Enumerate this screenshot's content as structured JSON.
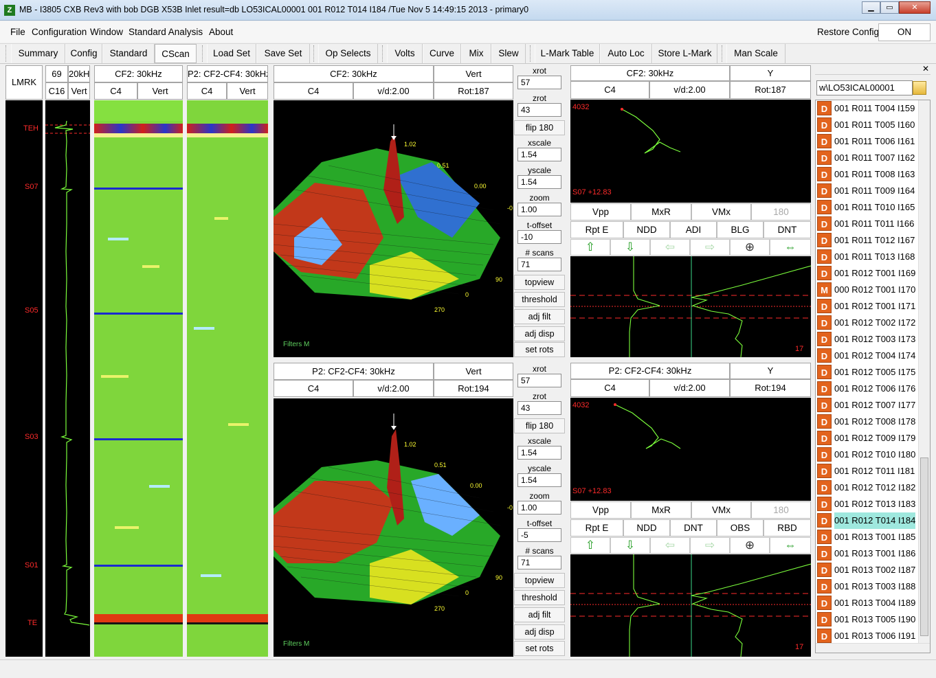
{
  "window": {
    "title": "MB - I3805  CXB Rev3 with bob DGB X53B Inlet result=db  LO53ICAL00001 001 R012 T014 I184 /Tue Nov 5 14:49:15 2013 - primary0",
    "logo": "Z",
    "min_glyph": "▁",
    "max_glyph": "▭",
    "close_glyph": "✕"
  },
  "menu": {
    "items": [
      "File",
      "Configuration",
      "Window",
      "Standard Analysis",
      "About"
    ],
    "restore_label": "Restore Config",
    "on_label": "ON"
  },
  "toolbar": {
    "buttons": [
      "Summary",
      "Config",
      "Standard",
      "CScan",
      "Load Set",
      "Save Set",
      "Op Selects",
      "Volts",
      "Curve",
      "Mix",
      "Slew",
      "L-Mark Table",
      "Auto Loc",
      "Store L-Mark",
      "Man Scale"
    ],
    "active": "CScan"
  },
  "strip": {
    "lmrk": "LMRK",
    "h1": "69",
    "h2": "20kHz",
    "h3": "C16",
    "h4": "Vert",
    "labels": [
      "TEH",
      "S07",
      "S05",
      "S03",
      "S01",
      "TE"
    ]
  },
  "cscan1": {
    "title": "CF2: 30kHz",
    "ch": "C4",
    "mode": "Vert"
  },
  "cscan2": {
    "title": "P2: CF2-CF4: 30kHz",
    "ch": "C4",
    "mode": "Vert"
  },
  "view3d_top": {
    "title": "CF2: 30kHz",
    "mode": "Vert",
    "ch": "C4",
    "vd": "v/d:2.00",
    "rot": "Rot:187",
    "peak": "1.02",
    "t1": "0.51",
    "t2": "0.00",
    "t3": "-0",
    "a1": "90",
    "a2": "0",
    "a3": "270",
    "filters": "Filters   M"
  },
  "view3d_bot": {
    "title": "P2: CF2-CF4: 30kHz",
    "mode": "Vert",
    "ch": "C4",
    "vd": "v/d:2.00",
    "rot": "Rot:194",
    "peak": "1.02",
    "t1": "0.51",
    "t2": "0.00",
    "t3": "-0",
    "a1": "90",
    "a2": "0",
    "a3": "270",
    "filters": "Filters   M"
  },
  "controls_top": {
    "xrot_lbl": "xrot",
    "xrot": "57",
    "zrot_lbl": "zrot",
    "zrot": "43",
    "flip": "flip 180",
    "xscale_lbl": "xscale",
    "xscale": "1.54",
    "yscale_lbl": "yscale",
    "yscale": "1.54",
    "zoom_lbl": "zoom",
    "zoom": "1.00",
    "toff_lbl": "t-offset",
    "toff": "-10",
    "scans_lbl": "# scans",
    "scans": "71",
    "topview": "topview",
    "threshold": "threshold",
    "adjfilt": "adj filt",
    "adjdisp": "adj disp",
    "setrots": "set rots"
  },
  "controls_bot": {
    "xrot_lbl": "xrot",
    "xrot": "57",
    "zrot_lbl": "zrot",
    "zrot": "43",
    "flip": "flip 180",
    "xscale_lbl": "xscale",
    "xscale": "1.54",
    "yscale_lbl": "yscale",
    "yscale": "1.54",
    "zoom_lbl": "zoom",
    "zoom": "1.00",
    "toff_lbl": "t-offset",
    "toff": "-5",
    "scans_lbl": "# scans",
    "scans": "71",
    "topview": "topview",
    "threshold": "threshold",
    "adjfilt": "adj filt",
    "adjdisp": "adj disp",
    "setrots": "set rots"
  },
  "liss_top": {
    "title": "CF2: 30kHz",
    "comp": "Y",
    "ch": "C4",
    "vd": "v/d:2.00",
    "rot": "Rot:187",
    "val": "4032",
    "loc": "S07 +12.83",
    "row1": [
      "Vpp",
      "MxR",
      "VMx",
      "180"
    ],
    "row2": [
      "Rpt E",
      "NDD",
      "ADI",
      "BLG",
      "DNT"
    ],
    "num": "17"
  },
  "liss_bot": {
    "title": "P2: CF2-CF4: 30kHz",
    "comp": "Y",
    "ch": "C4",
    "vd": "v/d:2.00",
    "rot": "Rot:194",
    "val": "4032",
    "loc": "S07 +12.83",
    "row1": [
      "Vpp",
      "MxR",
      "VMx",
      "180"
    ],
    "row2": [
      "Rpt E",
      "NDD",
      "DNT",
      "OBS",
      "RBD"
    ],
    "num": "17"
  },
  "icons": {
    "up": "⇧",
    "down": "⇩",
    "left": "⇦",
    "right": "⇨",
    "zoom": "⊕",
    "fit": "⇔"
  },
  "filelist": {
    "path": "w\\LO53ICAL00001",
    "badge": "D",
    "items": [
      {
        "b": "D",
        "t": "001 R011 T004 I159"
      },
      {
        "b": "D",
        "t": "001 R011 T005 I160"
      },
      {
        "b": "D",
        "t": "001 R011 T006 I161"
      },
      {
        "b": "D",
        "t": "001 R011 T007 I162"
      },
      {
        "b": "D",
        "t": "001 R011 T008 I163"
      },
      {
        "b": "D",
        "t": "001 R011 T009 I164"
      },
      {
        "b": "D",
        "t": "001 R011 T010 I165"
      },
      {
        "b": "D",
        "t": "001 R011 T011 I166"
      },
      {
        "b": "D",
        "t": "001 R011 T012 I167"
      },
      {
        "b": "D",
        "t": "001 R011 T013 I168"
      },
      {
        "b": "D",
        "t": "001 R012 T001 I169"
      },
      {
        "b": "M",
        "t": "000 R012 T001 I170"
      },
      {
        "b": "D",
        "t": "001 R012 T001 I171"
      },
      {
        "b": "D",
        "t": "001 R012 T002 I172"
      },
      {
        "b": "D",
        "t": "001 R012 T003 I173"
      },
      {
        "b": "D",
        "t": "001 R012 T004 I174"
      },
      {
        "b": "D",
        "t": "001 R012 T005 I175"
      },
      {
        "b": "D",
        "t": "001 R012 T006 I176"
      },
      {
        "b": "D",
        "t": "001 R012 T007 I177"
      },
      {
        "b": "D",
        "t": "001 R012 T008 I178"
      },
      {
        "b": "D",
        "t": "001 R012 T009 I179"
      },
      {
        "b": "D",
        "t": "001 R012 T010 I180"
      },
      {
        "b": "D",
        "t": "001 R012 T011 I181"
      },
      {
        "b": "D",
        "t": "001 R012 T012 I182"
      },
      {
        "b": "D",
        "t": "001 R012 T013 I183"
      },
      {
        "b": "D",
        "t": "001 R012 T014 I184"
      },
      {
        "b": "D",
        "t": "001 R013 T001 I185"
      },
      {
        "b": "D",
        "t": "001 R013 T001 I186"
      },
      {
        "b": "D",
        "t": "001 R013 T002 I187"
      },
      {
        "b": "D",
        "t": "001 R013 T003 I188"
      },
      {
        "b": "D",
        "t": "001 R013 T004 I189"
      },
      {
        "b": "D",
        "t": "001 R013 T005 I190"
      },
      {
        "b": "D",
        "t": "001 R013 T006 I191"
      }
    ],
    "selected_index": 25
  },
  "colors": {
    "signal": "#7cff3c",
    "label_red": "#ff2b2b",
    "cscan_green": "#7fd63c",
    "badge": "#e2631d",
    "selected": "#9fe8de"
  }
}
